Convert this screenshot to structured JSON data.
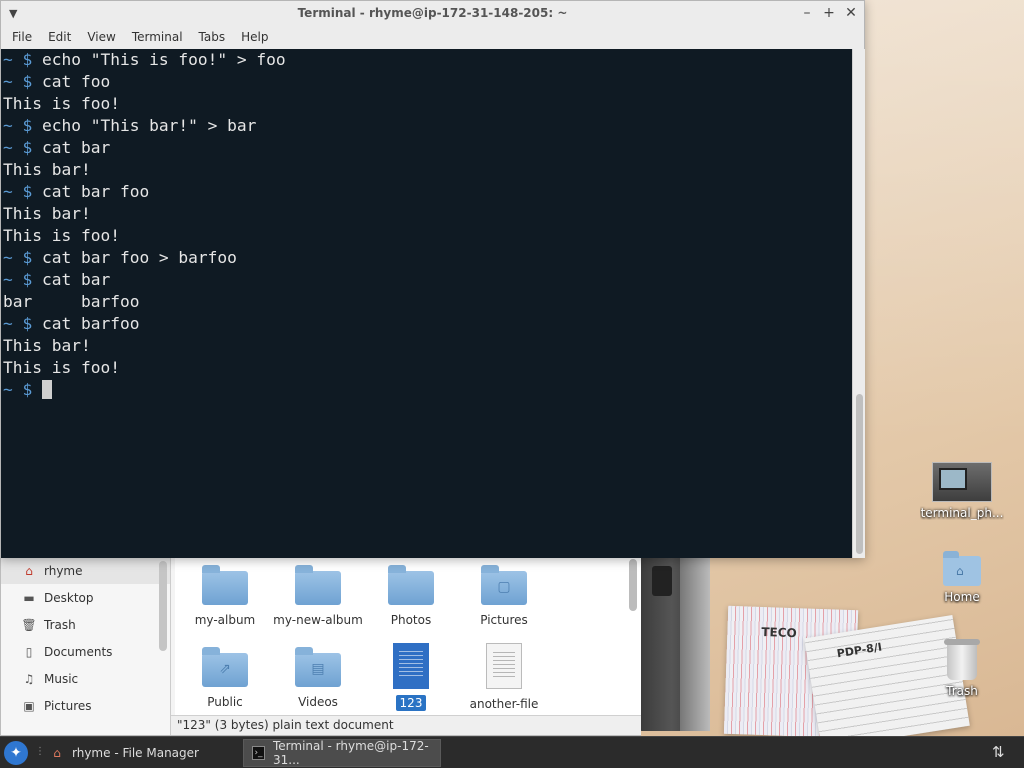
{
  "terminal": {
    "title": "Terminal - rhyme@ip-172-31-148-205: ~",
    "menus": [
      "File",
      "Edit",
      "View",
      "Terminal",
      "Tabs",
      "Help"
    ],
    "lines": [
      {
        "prompt": "~ $ ",
        "text": "echo \"This is foo!\" > foo"
      },
      {
        "prompt": "~ $ ",
        "text": "cat foo"
      },
      {
        "prompt": "",
        "text": "This is foo!"
      },
      {
        "prompt": "~ $ ",
        "text": "echo \"This bar!\" > bar"
      },
      {
        "prompt": "~ $ ",
        "text": "cat bar"
      },
      {
        "prompt": "",
        "text": "This bar!"
      },
      {
        "prompt": "~ $ ",
        "text": "cat bar foo"
      },
      {
        "prompt": "",
        "text": "This bar!"
      },
      {
        "prompt": "",
        "text": "This is foo!"
      },
      {
        "prompt": "~ $ ",
        "text": "cat bar foo > barfoo"
      },
      {
        "prompt": "~ $ ",
        "text": "cat bar"
      },
      {
        "prompt": "",
        "text": "bar     barfoo"
      },
      {
        "prompt": "~ $ ",
        "text": "cat barfoo"
      },
      {
        "prompt": "",
        "text": "This bar!"
      },
      {
        "prompt": "",
        "text": "This is foo!"
      }
    ],
    "current_prompt": "~ $ "
  },
  "file_manager": {
    "sidebar": [
      {
        "label": "rhyme",
        "icon": "home-icon"
      },
      {
        "label": "Desktop",
        "icon": "desktop-icon"
      },
      {
        "label": "Trash",
        "icon": "trash-icon"
      },
      {
        "label": "Documents",
        "icon": "documents-icon"
      },
      {
        "label": "Music",
        "icon": "music-icon"
      },
      {
        "label": "Pictures",
        "icon": "pictures-icon"
      }
    ],
    "items": [
      {
        "label": "my-album",
        "icon": "folder-icon"
      },
      {
        "label": "my-new-album",
        "icon": "folder-icon"
      },
      {
        "label": "Photos",
        "icon": "folder-icon"
      },
      {
        "label": "Pictures",
        "icon": "pictures-folder-icon"
      },
      {
        "label": "Public",
        "icon": "public-folder-icon"
      },
      {
        "label": "Videos",
        "icon": "videos-folder-icon"
      },
      {
        "label": "123",
        "icon": "text-document-icon",
        "selected": true
      },
      {
        "label": "another-file",
        "icon": "text-document-icon"
      }
    ],
    "status": "\"123\" (3 bytes) plain text document"
  },
  "desktop_icons": [
    {
      "label": "terminal_ph...",
      "icon": "image-file-icon"
    },
    {
      "label": "Home",
      "icon": "home-folder-icon"
    },
    {
      "label": "Trash",
      "icon": "trash-icon"
    }
  ],
  "wallpaper_labels": {
    "booklet1": "TECO",
    "booklet2": "PDP-8/I"
  },
  "taskbar": {
    "tasks": [
      {
        "label": "rhyme - File Manager",
        "icon": "home-icon",
        "active": false
      },
      {
        "label": "Terminal - rhyme@ip-172-31...",
        "icon": "terminal-icon",
        "active": true
      }
    ]
  },
  "colors": {
    "terminal_bg": "#0f1a23",
    "prompt": "#5b9bd5",
    "selection": "#2a73c4",
    "taskbar": "#2b2b2b"
  }
}
